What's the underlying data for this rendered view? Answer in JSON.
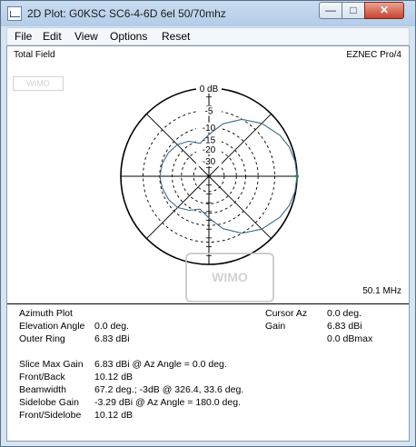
{
  "window": {
    "title": "2D Plot: G0KSC SC6-4-6D 6el 50/70mhz",
    "minimize_glyph": "—",
    "maximize_glyph": "□",
    "close_glyph": "✕"
  },
  "menu": [
    {
      "label": "File"
    },
    {
      "label": "Edit"
    },
    {
      "label": "View"
    },
    {
      "label": "Options"
    },
    {
      "label": "Reset"
    }
  ],
  "plot": {
    "field_label": "Total Field",
    "program_label": "EZNEC Pro/4",
    "frequency": "50.1 MHz",
    "ring_labels": [
      "0 dB",
      "-5",
      "-10",
      "-15",
      "-20",
      "-30"
    ],
    "trace_color": "#3a6e8a",
    "watermark": "WIMO"
  },
  "chart_data": {
    "type": "polar",
    "angles_deg": [
      0,
      10,
      20,
      30,
      45,
      60,
      75,
      90,
      105,
      120,
      135,
      150,
      165,
      175,
      180,
      185,
      195,
      210,
      225,
      240,
      255,
      270,
      285,
      300,
      315,
      330,
      340,
      350
    ],
    "gain_dbi": [
      6.83,
      6.7,
      6.3,
      5.6,
      4.0,
      1.8,
      -1.5,
      -6.0,
      -9.5,
      -6.5,
      -4.8,
      -4.0,
      -3.5,
      -3.4,
      -3.29,
      -3.4,
      -3.6,
      -4.1,
      -5.0,
      -7.0,
      -9.5,
      -6.0,
      -1.5,
      1.8,
      4.0,
      5.6,
      6.3,
      6.7
    ],
    "rings_db": [
      0,
      -5,
      -10,
      -15,
      -20,
      -30
    ],
    "outer_ring_dbi": 6.83
  },
  "info": {
    "azimuth_plot": "Azimuth Plot",
    "elevation_angle_label": "Elevation Angle",
    "elevation_angle_value": "0.0 deg.",
    "outer_ring_label": "Outer Ring",
    "outer_ring_value": "6.83 dBi",
    "cursor_az_label": "Cursor Az",
    "cursor_az_value": "0.0 deg.",
    "gain_label": "Gain",
    "gain_value": "6.83 dBi",
    "gain_dbmax": "0.0 dBmax",
    "slice_max_gain_label": "Slice Max Gain",
    "slice_max_gain_value": "6.83 dBi @ Az Angle = 0.0 deg.",
    "front_back_label": "Front/Back",
    "front_back_value": "10.12 dB",
    "beamwidth_label": "Beamwidth",
    "beamwidth_value": "67.2 deg.; -3dB @ 326.4, 33.6 deg.",
    "sidelobe_gain_label": "Sidelobe Gain",
    "sidelobe_gain_value": "-3.29 dBi @ Az Angle = 180.0 deg.",
    "front_sidelobe_label": "Front/Sidelobe",
    "front_sidelobe_value": "10.12 dB"
  }
}
